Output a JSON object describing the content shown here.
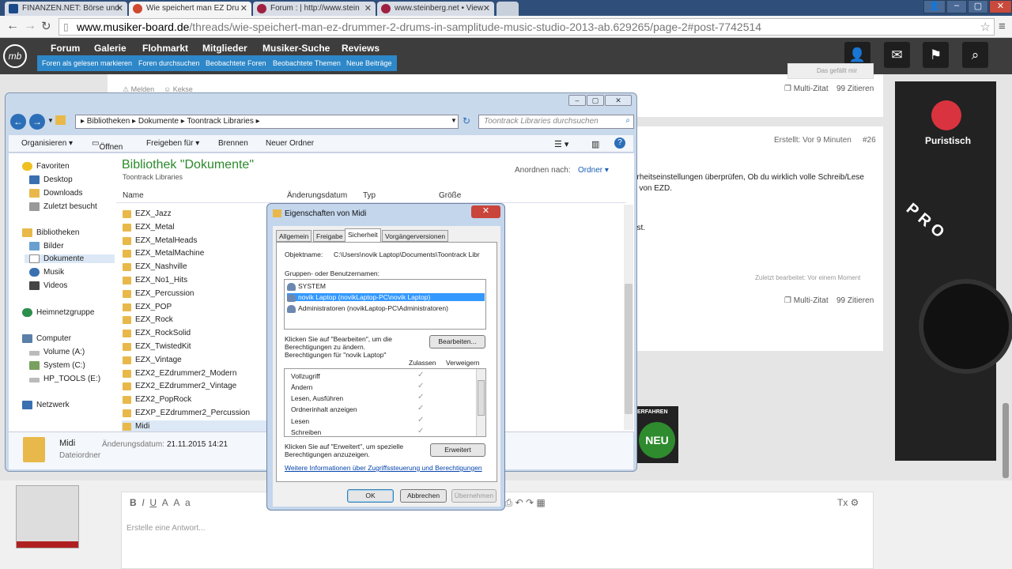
{
  "browser": {
    "tabs": [
      {
        "label": "FINANZEN.NET: Börse und",
        "color": "#1a4a8a"
      },
      {
        "label": "Wie speichert man EZ Dru",
        "color": "#d04a30"
      },
      {
        "label": "Forum : | http://www.stein",
        "color": "#a02040"
      },
      {
        "label": "www.steinberg.net • View",
        "color": "#a02040"
      }
    ],
    "url_host": "www.musiker-board.de",
    "url_path": "/threads/wie-speichert-man-ez-drummer-2-drums-in-samplitude-music-studio-2013-ab.629265/page-2#post-7742514"
  },
  "site": {
    "logo": "mb",
    "nav": [
      "Forum",
      "Galerie",
      "Flohmarkt",
      "Mitglieder",
      "Musiker-Suche",
      "Reviews"
    ],
    "subnav": [
      "Foren als gelesen markieren",
      "Foren durchsuchen",
      "Beobachtete Foren",
      "Beobachtete Themen",
      "Neue Beiträge"
    ],
    "post": {
      "melden": "Melden",
      "kekse": "Kekse",
      "multi_zitat": "Multi-Zitat",
      "zitieren": "Zitieren",
      "like": "Das gefällt mir",
      "created": "Erstellt: Vor 9 Minuten",
      "post_no": "#26",
      "text1": "erheitseinstellungen überprüfen, Ob du wirklich volle Schreib/Lese",
      "text2": "n von EZD.",
      "text3": "ast.",
      "edited": "Zuletzt bearbeitet: Vor einem Moment"
    },
    "ad_brand": "Puristisch",
    "ad_text": "PRO",
    "badge_text": "ERFAHREN",
    "badge_neu": "NEU",
    "reply_placeholder": "Erstelle eine Antwort..."
  },
  "explorer": {
    "breadcrumb": "▸ Bibliotheken ▸ Dokumente ▸ Toontrack Libraries ▸",
    "search_placeholder": "Toontrack Libraries durchsuchen",
    "toolbar": [
      "Organisieren ▾",
      "Öffnen",
      "Freigeben für ▾",
      "Brennen",
      "Neuer Ordner"
    ],
    "nav": {
      "favorites": "Favoriten",
      "fav_items": [
        "Desktop",
        "Downloads",
        "Zuletzt besucht"
      ],
      "libraries": "Bibliotheken",
      "lib_items": [
        "Bilder",
        "Dokumente",
        "Musik",
        "Videos"
      ],
      "homegroup": "Heimnetzgruppe",
      "computer": "Computer",
      "comp_items": [
        "Volume (A:)",
        "System (C:)",
        "HP_TOOLS (E:)"
      ],
      "network": "Netzwerk"
    },
    "library_title": "Bibliothek \"Dokumente\"",
    "library_sub": "Toontrack Libraries",
    "arrange_label": "Anordnen nach:",
    "arrange_value": "Ordner ▾",
    "columns": [
      "Name",
      "Änderungsdatum",
      "Typ",
      "Größe"
    ],
    "files": [
      "EZX_Jazz",
      "EZX_Metal",
      "EZX_MetalHeads",
      "EZX_MetalMachine",
      "EZX_Nashville",
      "EZX_No1_Hits",
      "EZX_Percussion",
      "EZX_POP",
      "EZX_Rock",
      "EZX_RockSolid",
      "EZX_TwistedKit",
      "EZX_Vintage",
      "EZX2_EZdrummer2_Modern",
      "EZX2_EZdrummer2_Vintage",
      "EZX2_PopRock",
      "EZXP_EZdrummer2_Percussion",
      "Midi"
    ],
    "status": {
      "name": "Midi",
      "type": "Dateiordner",
      "date_label": "Änderungsdatum:",
      "date": "21.11.2015 14:21"
    }
  },
  "dialog": {
    "title": "Eigenschaften von Midi",
    "tabs": [
      "Allgemein",
      "Freigabe",
      "Sicherheit",
      "Vorgängerversionen"
    ],
    "objekt_label": "Objektname:",
    "objekt_value": "C:\\Users\\novik Laptop\\Documents\\Toontrack Libr",
    "groups_label": "Gruppen- oder Benutzernamen:",
    "groups": [
      "SYSTEM",
      "novik Laptop (novikLaptop-PC\\novik Laptop)",
      "Administratoren (novikLaptop-PC\\Administratoren)"
    ],
    "edit_hint": "Klicken Sie auf \"Bearbeiten\", um die Berechtigungen zu ändern.",
    "edit_hint1": "Klicken Sie auf \"Bearbeiten\", um die",
    "edit_hint2": "Berechtigungen zu ändern.",
    "edit_button": "Bearbeiten...",
    "perm_for": "Berechtigungen für \"novik Laptop\"",
    "allow": "Zulassen",
    "deny": "Verweigern",
    "permissions": [
      "Vollzugriff",
      "Ändern",
      "Lesen, Ausführen",
      "Ordnerinhalt anzeigen",
      "Lesen",
      "Schreiben"
    ],
    "adv_hint1": "Klicken Sie auf \"Erweitert\", um spezielle",
    "adv_hint2": "Berechtigungen anzuzeigen.",
    "adv_button": "Erweitert",
    "link": "Weitere Informationen über Zugriffssteuerung und Berechtigungen",
    "ok": "OK",
    "cancel": "Abbrechen",
    "apply": "Übernehmen"
  }
}
